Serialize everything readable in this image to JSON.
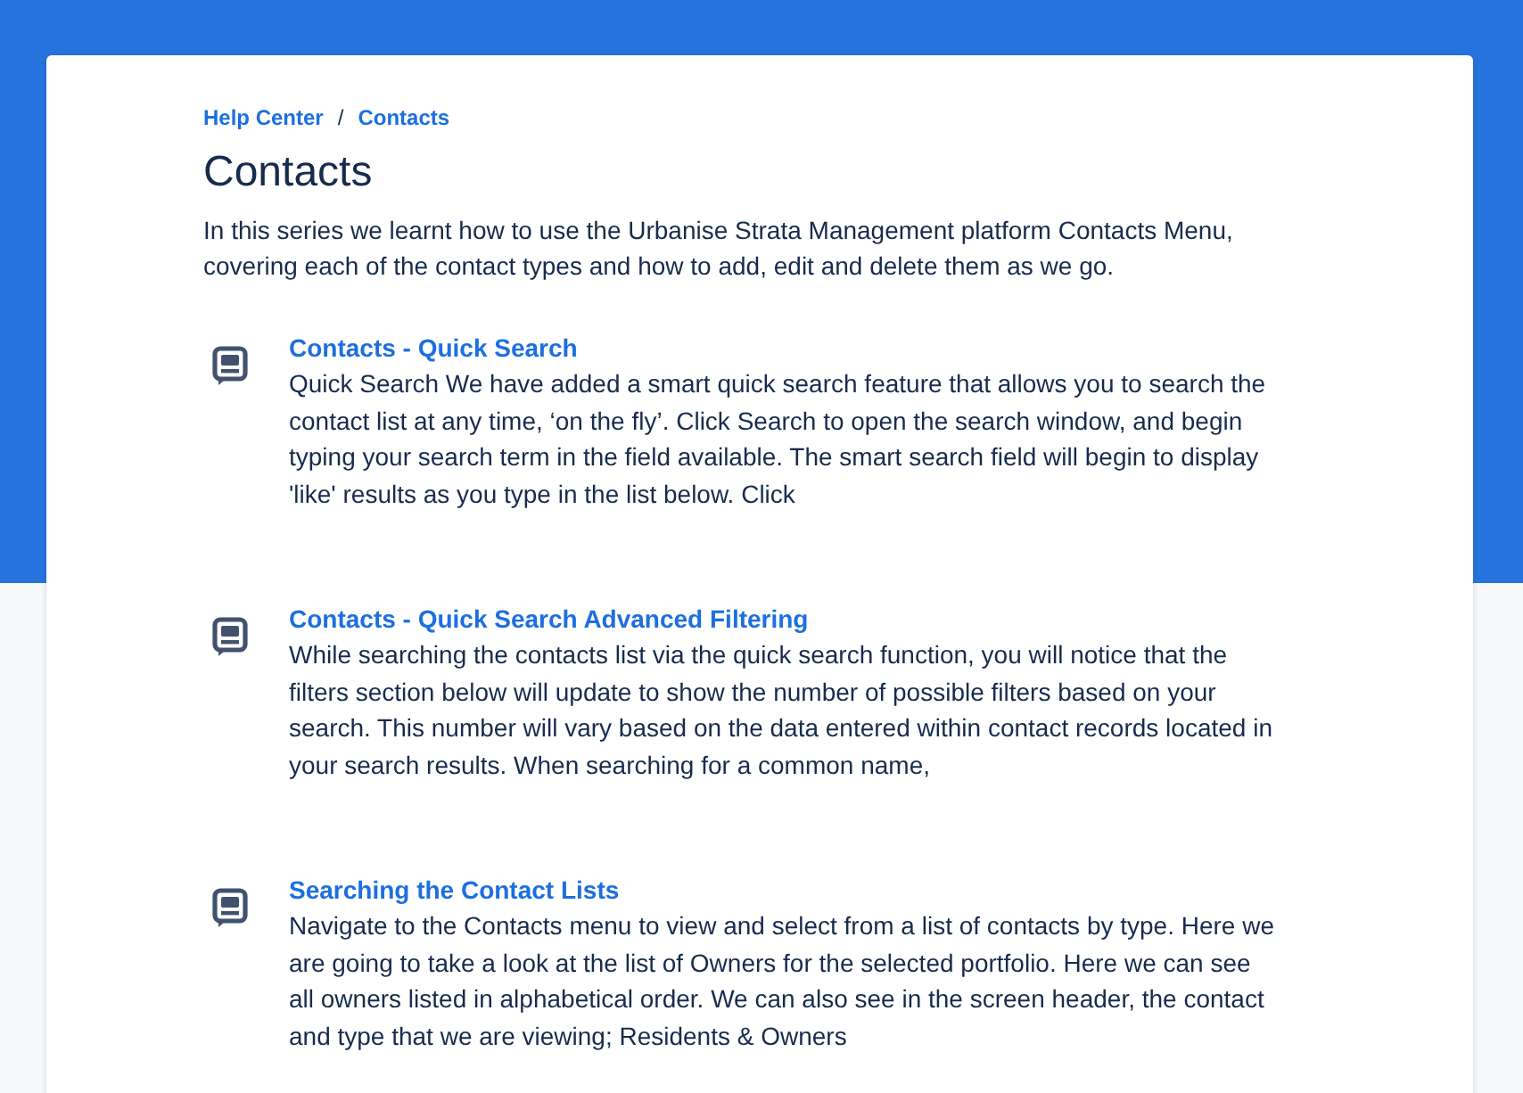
{
  "breadcrumb": {
    "items": [
      "Help Center",
      "Contacts"
    ],
    "separator": "/"
  },
  "page": {
    "title": "Contacts",
    "description": "In this series we learnt how to use the Urbanise Strata Management platform Contacts Menu, covering each of the contact types and how to add, edit and delete them as we go."
  },
  "articles": [
    {
      "title": "Contacts - Quick Search",
      "excerpt": "Quick Search We have added a smart quick search feature that allows you to search the contact list at any time, ‘on the fly’. Click Search to open the search window, and begin typing your search term in the field available. The smart search field will begin to display 'like' results as you type in the list below. Click"
    },
    {
      "title": "Contacts - Quick Search Advanced Filtering",
      "excerpt": "While searching the contacts list via the quick search function, you will notice that the filters section below will update to show the number of possible filters based on your search. This number will vary based on the data entered within contact records located in your search results. When searching for a common name,"
    },
    {
      "title": "Searching the Contact Lists",
      "excerpt": "Navigate to the Contacts menu to view and select from a list of contacts by type. Here we are going to take a look at the list of Owners for the selected portfolio. Here we can see all owners listed in alphabetical order. We can also see in the screen header, the contact and type that we are viewing; Residents & Owners"
    }
  ]
}
